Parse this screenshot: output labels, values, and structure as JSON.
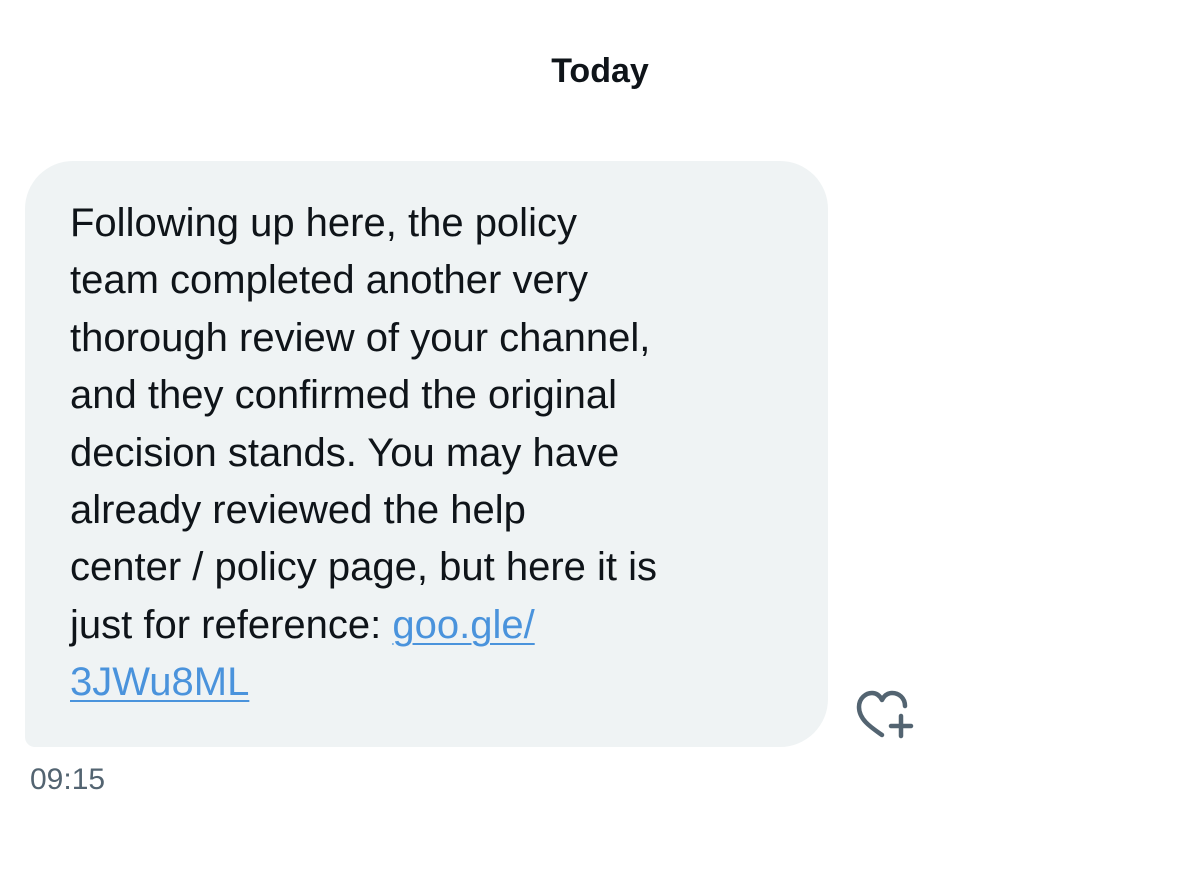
{
  "conversation": {
    "date_separator": "Today"
  },
  "message": {
    "text_before_link": "Following up here, the policy\nteam completed another very\nthorough review of your channel,\nand they confirmed the original\ndecision stands. You may have\nalready reviewed the help\ncenter / policy page, but here it is\njust for reference: ",
    "link_text": "goo.gle/\n3JWu8ML",
    "timestamp": "09:15"
  },
  "icons": {
    "react": "heart-plus-icon"
  },
  "colors": {
    "bubble_bg": "#eff3f4",
    "link": "#4a93dc",
    "timestamp": "#536471",
    "text": "#0f1419"
  }
}
